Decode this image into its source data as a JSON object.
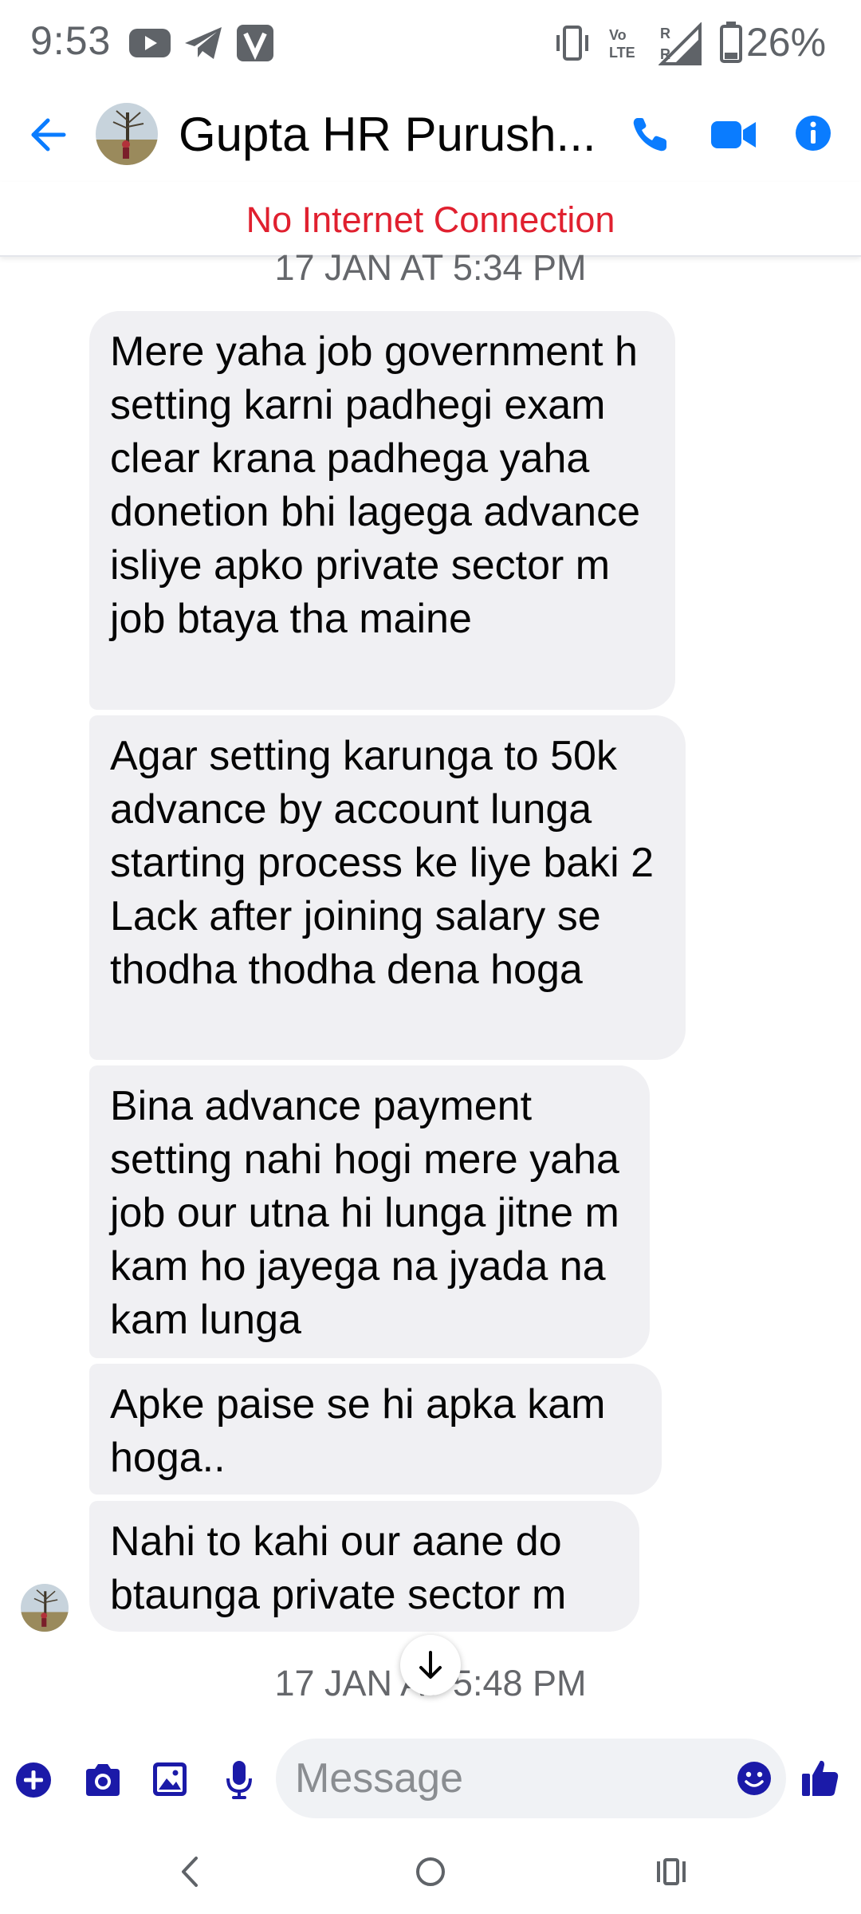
{
  "status_bar": {
    "time": "9:53",
    "battery": "26%",
    "icons": [
      "youtube-icon",
      "telegram-icon",
      "v-app-icon",
      "vibrate-icon",
      "volte-icon",
      "signal-icon",
      "battery-icon"
    ]
  },
  "header": {
    "contact_name": "Gupta HR Purush...",
    "back_icon": "arrow-left-icon",
    "call_icon": "phone-icon",
    "video_icon": "video-camera-icon",
    "info_icon": "info-icon"
  },
  "banner": {
    "text": "No Internet Connection"
  },
  "chat": {
    "timestamp_top": "17 JAN AT 5:34 PM",
    "messages": [
      "Mere yaha job government h setting karni padhegi exam clear krana padhega yaha donetion bhi lagega advance isliye apko private sector m job btaya tha maine",
      "Agar setting karunga to 50k advance by account lunga starting process ke liye baki 2 Lack after joining salary se thodha thodha dena hoga",
      "Bina advance payment setting nahi hogi mere yaha job our utna hi lunga jitne m kam ho jayega na jyada na kam lunga",
      "Apke paise se hi apka kam hoga..",
      "Nahi to kahi our aane do btaunga private sector m"
    ],
    "timestamp_bottom": "17 JAN AT 5:48 PM"
  },
  "composer": {
    "placeholder": "Message",
    "icons": [
      "plus-icon",
      "camera-icon",
      "gallery-icon",
      "microphone-icon",
      "emoji-icon",
      "thumbs-up-icon"
    ]
  },
  "navbar": {
    "icons": [
      "nav-back-icon",
      "nav-home-icon",
      "nav-recents-icon"
    ]
  },
  "colors": {
    "accent": "#0a7cff",
    "composer_accent": "#1b1aa8",
    "banner_text": "#e0202f",
    "bubble_bg": "#f0f0f3",
    "muted": "#65676b"
  }
}
